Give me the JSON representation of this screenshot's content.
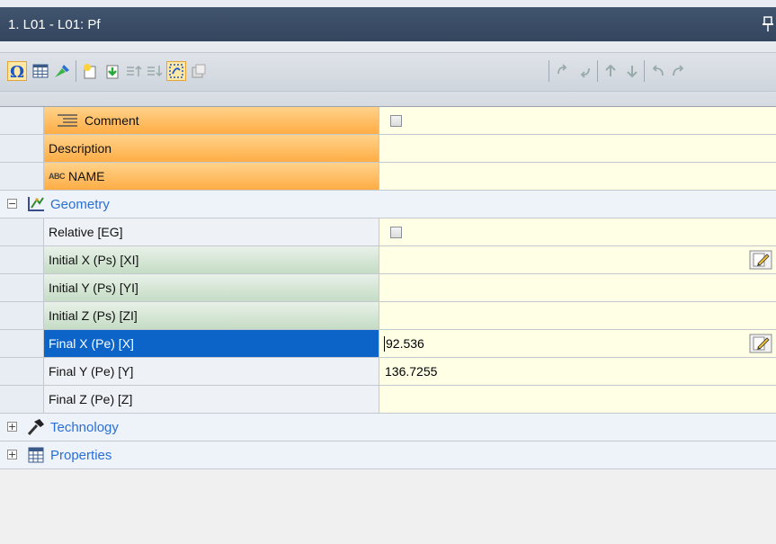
{
  "window": {
    "title": "1. L01 - L01: Pf"
  },
  "icons": {
    "pin": "pin-icon",
    "toolbar": [
      "omega-icon",
      "calendar-grid-icon",
      "draw-icon",
      "new-item-icon",
      "import-icon",
      "move-up-icon",
      "move-down-icon",
      "select-icon",
      "copy-icon",
      "nav-start-icon",
      "nav-back-icon",
      "nav-up-icon",
      "nav-down-icon",
      "undo-icon",
      "redo-icon"
    ]
  },
  "rows": {
    "comment": {
      "label": "Comment",
      "checked": false
    },
    "description": {
      "label": "Description",
      "value": ""
    },
    "name": {
      "label": "NAME",
      "badge": "ABC",
      "value": ""
    }
  },
  "categories": {
    "geometry": {
      "label": "Geometry",
      "expander": "−"
    },
    "technology": {
      "label": "Technology",
      "expander": "+"
    },
    "properties": {
      "label": "Properties",
      "expander": "+"
    }
  },
  "geometry": {
    "relative": {
      "label": "Relative [EG]",
      "checked": false
    },
    "initial_x": {
      "label": "Initial X (Ps) [XI]",
      "value": ""
    },
    "initial_y": {
      "label": "Initial Y (Ps) [YI]",
      "value": ""
    },
    "initial_z": {
      "label": "Initial Z (Ps) [ZI]",
      "value": ""
    },
    "final_x": {
      "label": "Final X (Pe) [X]",
      "value": "92.536"
    },
    "final_y": {
      "label": "Final Y (Pe) [Y]",
      "value": "136.7255"
    },
    "final_z": {
      "label": "Final Z (Pe) [Z]",
      "value": ""
    }
  },
  "colors": {
    "title_bg": "#3b4d66",
    "selected_bg": "#0c64c8",
    "value_bg": "#ffffe6",
    "category_text": "#2a6fd6",
    "orange_row": "#ffb655",
    "green_row": "#d6e7d6"
  }
}
